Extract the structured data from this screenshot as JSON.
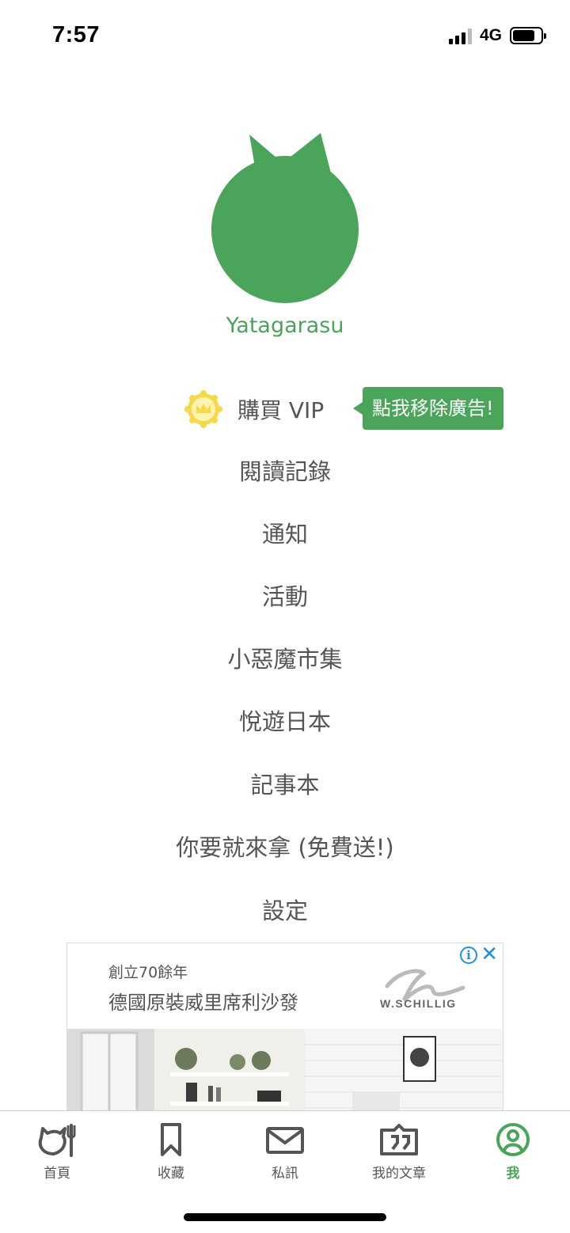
{
  "status_bar": {
    "time": "7:57",
    "network": "4G",
    "battery_level": 0.8
  },
  "profile": {
    "username": "Yatagarasu",
    "avatar_color": "#4aa45a"
  },
  "vip": {
    "label": "購買 VIP",
    "tooltip": "點我移除廣告!",
    "badge_color": "#f5d94b"
  },
  "menu": [
    "閱讀記錄",
    "通知",
    "活動",
    "小惡魔市集",
    "悅遊日本",
    "記事本",
    "你要就來拿 (免費送!)",
    "設定"
  ],
  "ad": {
    "line1": "創立70餘年",
    "line2": "德國原裝威里席利沙發",
    "brand": "W.SCHILLIG",
    "info_icon": "i",
    "close_icon": "✕"
  },
  "tabs": [
    {
      "label": "首頁",
      "icon": "home-icon"
    },
    {
      "label": "收藏",
      "icon": "bookmark-icon"
    },
    {
      "label": "私訊",
      "icon": "mail-icon"
    },
    {
      "label": "我的文章",
      "icon": "article-icon"
    },
    {
      "label": "我",
      "icon": "profile-icon",
      "active": true
    }
  ],
  "colors": {
    "accent": "#4aa45a",
    "text": "#555555",
    "ad_icon": "#1f8fe0"
  }
}
